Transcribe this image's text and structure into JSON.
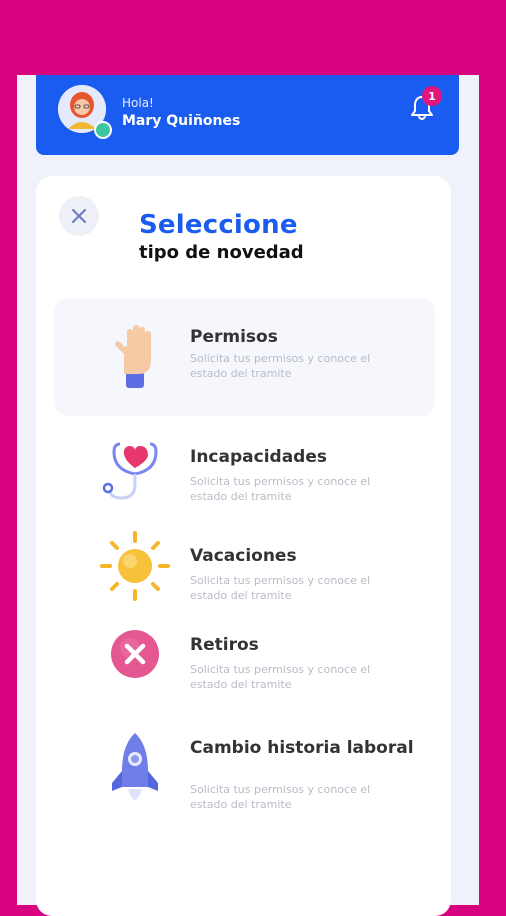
{
  "user": {
    "greeting": "Hola!",
    "name": "Mary Quiñones",
    "notification_count": "1"
  },
  "screen": {
    "title": "Seleccione",
    "subtitle": "tipo de novedad"
  },
  "options": [
    {
      "label": "Permisos",
      "desc": "Solicita tus permisos y conoce el estado del tramite",
      "icon": "hand-icon"
    },
    {
      "label": "Incapacidades",
      "desc": "Solicita tus permisos y conoce el estado del tramite",
      "icon": "stethoscope-heart-icon"
    },
    {
      "label": "Vacaciones",
      "desc": "Solicita tus permisos y conoce el estado del tramite",
      "icon": "sun-icon"
    },
    {
      "label": "Retiros",
      "desc": "Solicita tus permisos y conoce el estado del tramite",
      "icon": "x-circle-icon"
    },
    {
      "label": "Cambio historia laboral",
      "desc": "Solicita tus permisos y conoce el estado del tramite",
      "icon": "rocket-icon"
    }
  ],
  "colors": {
    "background": "#d8037f",
    "primary": "#1b5cf0",
    "badge": "#e0157d"
  }
}
